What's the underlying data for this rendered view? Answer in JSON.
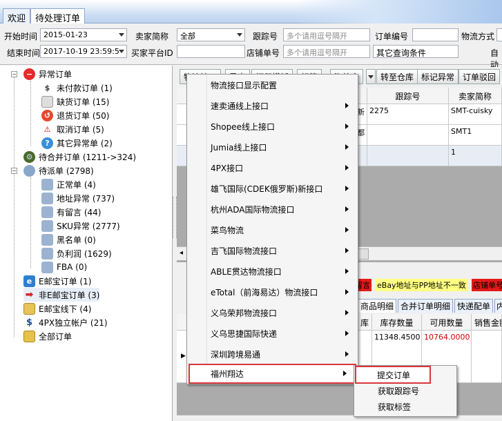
{
  "tabs": [
    "欢迎",
    "待处理订单"
  ],
  "filters": {
    "start_label": "开始时间",
    "start_value": "2015-01-23",
    "end_label": "结束时间",
    "end_value": "2017-10-19 23:59:5",
    "seller_label": "卖家简称",
    "seller_value": "全部",
    "buyer_label": "买家平台ID",
    "tracking_label": "跟踪号",
    "tracking_placeholder": "多个请用逗号隔开",
    "store_order_label": "店铺单号",
    "store_order_placeholder": "多个请用逗号隔开",
    "order_no_label": "订单编号",
    "shipping_label": "物流方式",
    "other_label": "其它查询条件",
    "auto_label": "自动"
  },
  "tree": {
    "abnormal": "异常订单",
    "unpaid": "未付款订单 (1)",
    "shortage": "缺货订单 (15)",
    "returned": "退货订单 (50)",
    "cancelled": "取消订单 (5)",
    "other_abnormal": "其它异常单 (2)",
    "to_merge": "待合并订单 (1211->324)",
    "to_dispatch": "待派单 (2798)",
    "normal": "正常单 (4)",
    "addr_abnormal": "地址异常 (737)",
    "has_note": "有留言 (44)",
    "sku_abnormal": "SKU异常 (2777)",
    "blacklist": "黑名单 (0)",
    "neg_profit": "负利润 (1629)",
    "fba": "FBA (0)",
    "ebay_order": "E邮宝订单 (1)",
    "non_ebay": "非E邮宝订单 (3)",
    "ebay_offline": "E邮宝线下 (4)",
    "px_account": "4PX独立帐户 (21)",
    "all_orders": "全部订单"
  },
  "toolbar": {
    "b1": "物流接口",
    "b2": "导出",
    "b3": "打印模板",
    "b4": "标签",
    "b5": "海外仓",
    "b6": "转至仓库",
    "b7": "标记异常",
    "b8": "订单驳回"
  },
  "grid": {
    "col_tracking": "跟踪号",
    "col_seller": "卖家简称",
    "row1_frag": "新",
    "row1_tracking": "2275",
    "row1_seller": "SMT-cuisky",
    "row2_frag": "都",
    "row2_seller": "SMT1",
    "row3_seller": "1"
  },
  "warn": {
    "red_frag": "留言",
    "yellow_text": "eBay地址与PP地址不一致",
    "store_frag": "店铺单号"
  },
  "bottom_tabs": [
    "商品明细",
    "合并订单明细",
    "快递配单",
    "内"
  ],
  "detail": {
    "col_frag": "库",
    "col_stock": "库存数量",
    "col_available": "可用数量",
    "col_sales": "销售金额",
    "stock_value": "11348.4500",
    "available_value": "10764.0000"
  },
  "menu": {
    "items": [
      "物流接口显示配置",
      "速卖通线上接口",
      "Shopee线上接口",
      "Jumia线上接口",
      "4PX接口",
      "雄飞国际(CDEK俄罗斯)新接口",
      "杭州ADA国际物流接口",
      "菜鸟物流",
      "吉飞国际物流接口",
      "ABLE贯达物流接口",
      "eTotal（前海易达）物流接口",
      "义乌荣邦物流接口",
      "义乌思捷国际快递",
      "深圳跨境易通",
      "福州翔达"
    ]
  },
  "submenu": {
    "items": [
      "提交订单",
      "获取跟踪号",
      "获取标签"
    ]
  },
  "colors": {
    "highlight": "#d9353b",
    "available_red": "#d40000",
    "warn_yellow": "#ffff80",
    "warn_red": "#e21a1a"
  }
}
